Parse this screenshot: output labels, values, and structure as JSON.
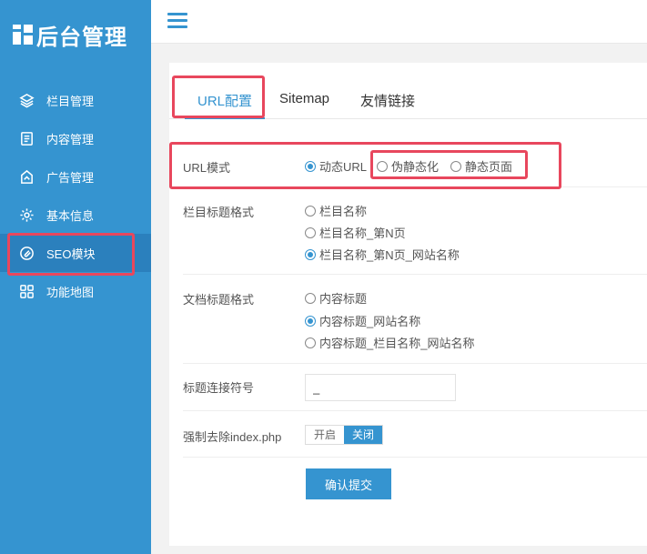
{
  "app": {
    "title": "后台管理"
  },
  "sidebar": {
    "items": [
      {
        "label": "栏目管理",
        "icon": "layers-icon"
      },
      {
        "label": "内容管理",
        "icon": "document-icon"
      },
      {
        "label": "广告管理",
        "icon": "ad-icon"
      },
      {
        "label": "基本信息",
        "icon": "gear-icon"
      },
      {
        "label": "SEO模块",
        "icon": "paperclip-icon",
        "active": true
      },
      {
        "label": "功能地图",
        "icon": "grid-icon"
      }
    ]
  },
  "tabs": [
    "URL配置",
    "Sitemap",
    "友情链接"
  ],
  "form": {
    "url_mode": {
      "label": "URL模式",
      "options": [
        "动态URL",
        "伪静态化",
        "静态页面"
      ],
      "selected": "动态URL"
    },
    "column_title_format": {
      "label": "栏目标题格式",
      "options": [
        "栏目名称",
        "栏目名称_第N页",
        "栏目名称_第N页_网站名称"
      ],
      "selected": "栏目名称_第N页_网站名称"
    },
    "doc_title_format": {
      "label": "文档标题格式",
      "options": [
        "内容标题",
        "内容标题_网站名称",
        "内容标题_栏目名称_网站名称"
      ],
      "selected": "内容标题_网站名称"
    },
    "separator": {
      "label": "标题连接符号",
      "value": "_"
    },
    "force_remove_index": {
      "label": "强制去除index.php",
      "on_label": "开启",
      "off_label": "关闭",
      "value": "关闭"
    },
    "submit_label": "确认提交"
  },
  "colors": {
    "accent": "#3594d0",
    "sidebar_active": "#2b80bd",
    "highlight": "#e8475d"
  }
}
